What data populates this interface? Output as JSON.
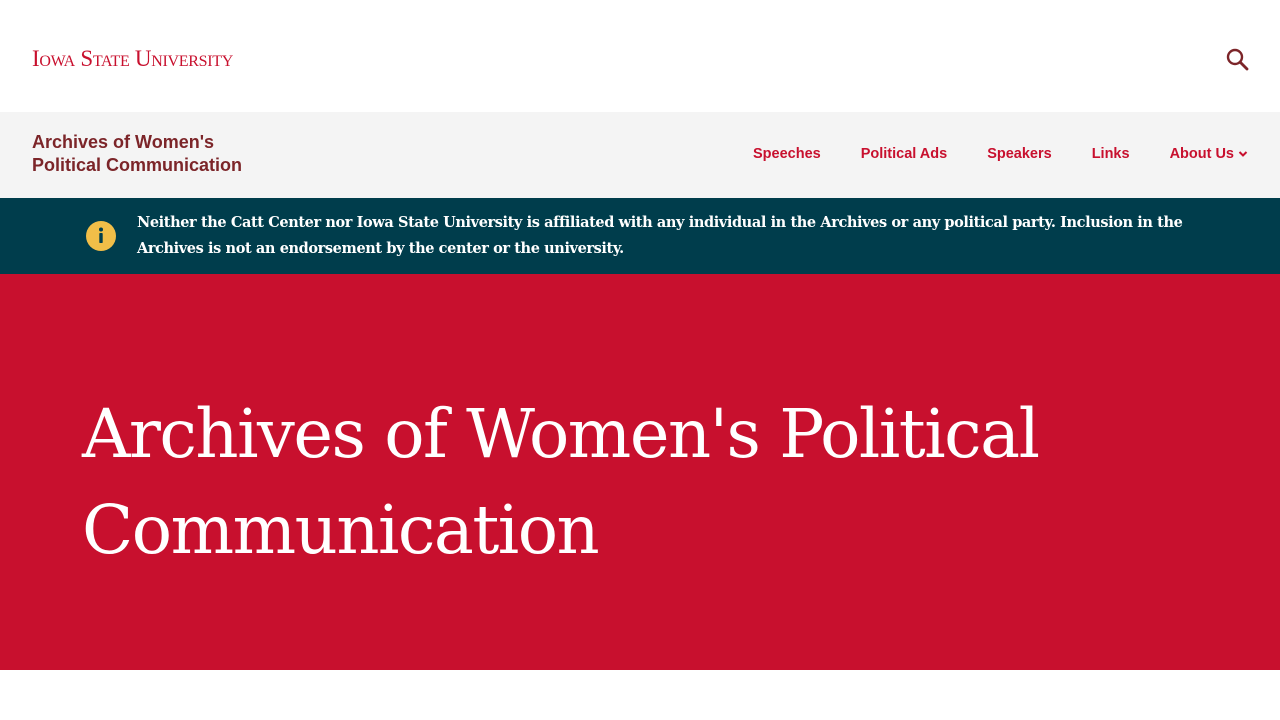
{
  "header": {
    "logo_text": "Iowa State University",
    "search_icon": "search-icon"
  },
  "site": {
    "title_line1": "Archives of Women's",
    "title_line2": "Political Communication"
  },
  "nav": {
    "items": [
      {
        "label": "Speeches"
      },
      {
        "label": "Political Ads"
      },
      {
        "label": "Speakers"
      },
      {
        "label": "Links"
      },
      {
        "label": "About Us",
        "icon": "chevron-down-icon"
      }
    ]
  },
  "notice": {
    "icon": "info-icon",
    "text": "Neither the Catt Center nor Iowa State University is affiliated with any individual in the Archives or any political party. Inclusion in the Archives is not an endorsement by the center or the university."
  },
  "hero": {
    "title": "Archives of Women's Political Communication"
  },
  "colors": {
    "brand_red": "#c8102e",
    "title_maroon": "#7c2529",
    "notice_bg": "#003d4c",
    "info_yellow": "#f1be48"
  }
}
